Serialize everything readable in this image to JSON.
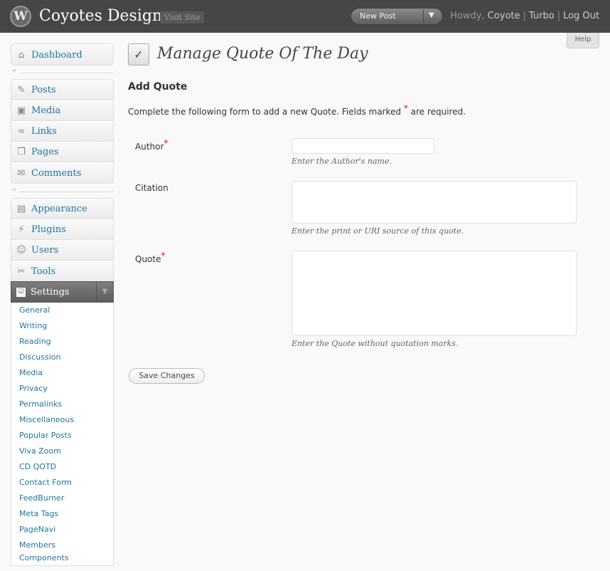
{
  "header": {
    "logo_letter": "W",
    "site_title": "Coyotes Designs",
    "visit_site": "Visit Site",
    "new_post": "New Post",
    "new_post_arrow": "▼",
    "howdy": "Howdy, ",
    "user": "Coyote",
    "turbo": "Turbo",
    "logout": "Log Out",
    "separator": "|"
  },
  "help": "Help",
  "sidebar": {
    "dashboard": {
      "label": "Dashboard",
      "icon": "⌂"
    },
    "separator_arrows": "«",
    "group1": [
      {
        "label": "Posts",
        "icon": "✎"
      },
      {
        "label": "Media",
        "icon": "▣"
      },
      {
        "label": "Links",
        "icon": "∞"
      },
      {
        "label": "Pages",
        "icon": "❐"
      },
      {
        "label": "Comments",
        "icon": "✉"
      }
    ],
    "group2": [
      {
        "label": "Appearance",
        "icon": "▤"
      },
      {
        "label": "Plugins",
        "icon": "⚡"
      },
      {
        "label": "Users",
        "icon": "☺"
      },
      {
        "label": "Tools",
        "icon": "✂"
      }
    ],
    "settings": {
      "label": "Settings",
      "icon": "☑",
      "toggle": "▼"
    },
    "settings_sub": [
      "General",
      "Writing",
      "Reading",
      "Discussion",
      "Media",
      "Privacy",
      "Permalinks",
      "Miscellaneous",
      "Popular Posts",
      "Viva Zoom",
      "CD QOTD",
      "Contact Form",
      "FeedBurner",
      "Meta Tags",
      "PageNavi",
      "Members",
      "Components"
    ]
  },
  "main": {
    "page_icon": "✓",
    "title": "Manage Quote Of The Day",
    "section_title": "Add Quote",
    "intro_before": "Complete the following form to add a new Quote. Fields marked ",
    "intro_star": "*",
    "intro_after": " are required.",
    "fields": {
      "author": {
        "label": "Author",
        "required": "*",
        "value": "",
        "help": "Enter the Author's name."
      },
      "citation": {
        "label": "Citation",
        "value": "",
        "help": "Enter the print or URI source of this quote."
      },
      "quote": {
        "label": "Quote",
        "required": "*",
        "value": "",
        "help": "Enter the Quote without quotation marks."
      }
    },
    "save_button": "Save Changes"
  }
}
